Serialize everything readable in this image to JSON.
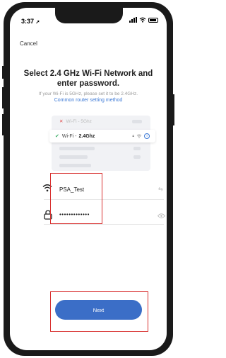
{
  "status_bar": {
    "time": "3:37"
  },
  "nav": {
    "cancel_label": "Cancel"
  },
  "header": {
    "title_line1": "Select 2.4 GHz Wi-Fi Network and",
    "title_line2": "enter password.",
    "subtitle": "If your Wi-Fi is 5GHz, please set it to be 2.4GHz.",
    "link": "Common router setting method"
  },
  "illustration": {
    "network_5g_prefix": "Wi-Fi - ",
    "network_5g_band": "5Ghz",
    "network_24_prefix": "Wi-Fi - ",
    "network_24_band": "2.4Ghz"
  },
  "form": {
    "ssid_value": "PSA_Test",
    "password_value": "•••••••••••••"
  },
  "actions": {
    "next_label": "Next"
  },
  "colors": {
    "accent": "#3b6ec7",
    "link": "#3d7ad6",
    "highlight": "#d8302f",
    "success": "#3fb06a",
    "error": "#e14c4c"
  }
}
